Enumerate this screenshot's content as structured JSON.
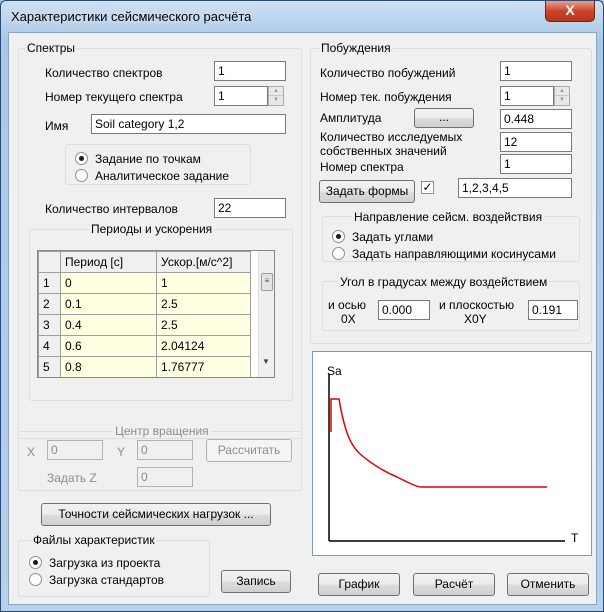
{
  "window": {
    "title": "Характеристики сейсмического расчёта",
    "close_label": "X"
  },
  "spectra": {
    "legend": "Спектры",
    "count_label": "Количество спектров",
    "count_value": "1",
    "current_label": "Номер текущего спектра",
    "current_value": "1",
    "name_label": "Имя",
    "name_value": "Soil category 1,2",
    "mode_points": "Задание по точкам",
    "mode_analytic": "Аналитическое задание",
    "intervals_label": "Количество интервалов",
    "intervals_value": "22",
    "table": {
      "legend": "Периоды и ускорения",
      "col_period": "Период [с]",
      "col_accel": "Ускор.[м/с^2]",
      "rows": [
        {
          "n": "1",
          "period": "0",
          "accel": "1"
        },
        {
          "n": "2",
          "period": "0.1",
          "accel": "2.5"
        },
        {
          "n": "3",
          "period": "0.4",
          "accel": "2.5"
        },
        {
          "n": "4",
          "period": "0.6",
          "accel": "2.04124"
        },
        {
          "n": "5",
          "period": "0.8",
          "accel": "1.76777"
        }
      ]
    }
  },
  "rotation": {
    "legend": "Центр вращения",
    "x_label": "X",
    "x_value": "0",
    "y_label": "Y",
    "y_value": "0",
    "calc_label": "Рассчитать",
    "z_label": "Задать Z",
    "z_value": "0"
  },
  "accuracy_button": "Точности сейсмических нагрузок ...",
  "files": {
    "legend": "Файлы характеристик",
    "from_project": "Загрузка из проекта",
    "standards": "Загрузка стандартов",
    "write_label": "Запись"
  },
  "excitations": {
    "legend": "Побуждения",
    "count_label": "Количество побуждений",
    "count_value": "1",
    "current_label": "Номер тек. побуждения",
    "current_value": "1",
    "amplitude_label": "Амплитуда",
    "amplitude_button": "...",
    "amplitude_value": "0.448",
    "eigen_label_1": "Количество исследуемых",
    "eigen_label_2": "собственных значений",
    "eigen_value": "12",
    "spectrum_label": "Номер спектра",
    "spectrum_value": "1",
    "forms_button": "Задать формы",
    "forms_checked": "✓",
    "forms_value": "1,2,3,4,5"
  },
  "direction": {
    "legend": "Направление сейсм. воздействия",
    "by_angles": "Задать углами",
    "by_cosines": "Задать направляющими косинусами"
  },
  "angles": {
    "legend": "Угол в градусах между воздействием",
    "axis_label_1": "и осью",
    "axis_label_2": "0X",
    "axis_value": "0.000",
    "plane_label_1": "и плоскостью",
    "plane_label_2": "X0Y",
    "plane_value": "0.191"
  },
  "plot": {
    "y_label": "Sa",
    "x_label": "T"
  },
  "buttons": {
    "graph": "График",
    "calc": "Расчёт",
    "cancel": "Отменить"
  },
  "colors": {
    "curve": "#e00000",
    "axis": "#000000"
  }
}
